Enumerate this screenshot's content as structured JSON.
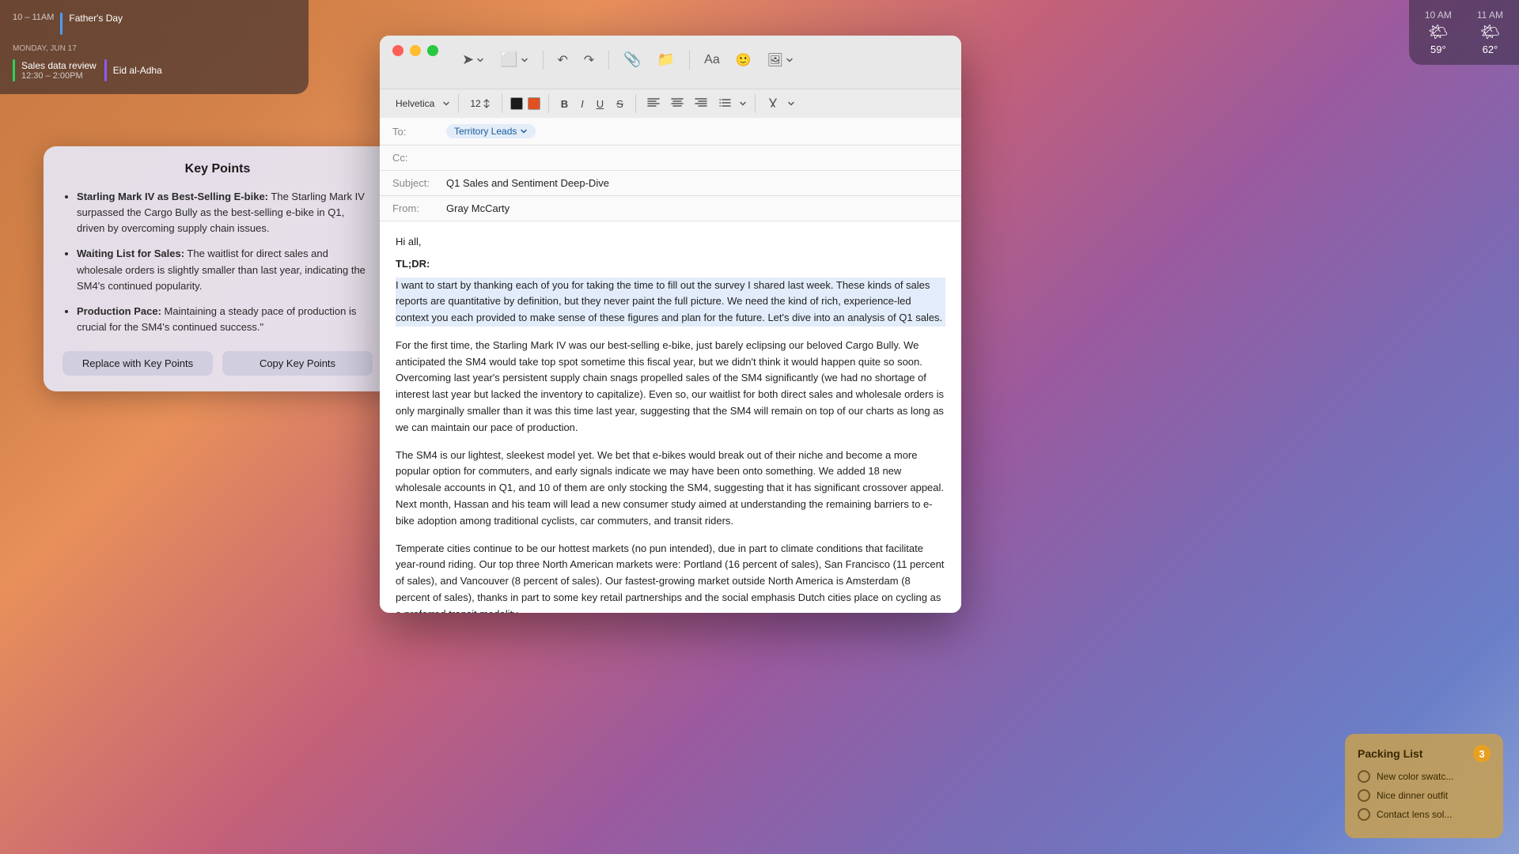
{
  "desktop": {
    "background": "gradient"
  },
  "calendar_widget": {
    "row1_time": "10 – 11AM",
    "row1_event": "Father's Day",
    "row2_label": "MONDAY, JUN 17",
    "row2_time": "12:30 – 2:00PM",
    "row2_event": "Sales data review",
    "row2_event2": "Eid al-Adha"
  },
  "weather_widget": {
    "time1": "10 AM",
    "time2": "11 AM",
    "icon1": "🌤",
    "icon2": "🌤",
    "temp1": "59°",
    "temp2": "62°"
  },
  "packing_list": {
    "title": "Packing List",
    "count": "3",
    "items": [
      {
        "text": "New color swatc...",
        "checked": false
      },
      {
        "text": "Nice dinner outfit",
        "checked": false
      },
      {
        "text": "Contact lens sol...",
        "checked": false
      }
    ]
  },
  "key_points": {
    "title": "Key Points",
    "points": [
      {
        "bold": "Starling Mark IV as Best-Selling E-bike:",
        "text": " The Starling Mark IV surpassed the Cargo Bully as the best-selling e-bike in Q1, driven by overcoming supply chain issues."
      },
      {
        "bold": "Waiting List for Sales:",
        "text": " The waitlist for direct sales and wholesale orders is slightly smaller than last year, indicating the SM4's continued popularity."
      },
      {
        "bold": "Production Pace:",
        "text": " Maintaining a steady pace of production is crucial for the SM4's continued success.\""
      }
    ],
    "btn_replace": "Replace with Key Points",
    "btn_copy": "Copy Key Points"
  },
  "email_window": {
    "to_chip": "Territory Leads",
    "cc": "",
    "subject": "Q1 Sales and Sentiment Deep-Dive",
    "from": "Gray McCarty",
    "toolbar": {
      "send_icon": "➤",
      "attach_icon": "📎",
      "font_name": "Helvetica",
      "font_size": "12",
      "bold": "B",
      "italic": "I",
      "underline": "U",
      "strikethrough": "S"
    },
    "body": {
      "greeting": "Hi all,",
      "tldr": "TL;DR:",
      "para1": "I want to start by thanking each of you for taking the time to fill out the survey I shared last week. These kinds of sales reports are quantitative by definition, but they never paint the full picture. We need the kind of rich, experience-led context you each provided to make sense of these figures and plan for the future. Let's dive into an analysis of Q1 sales.",
      "para2": "For the first time, the Starling Mark IV was our best-selling e-bike, just barely eclipsing our beloved Cargo Bully. We anticipated the SM4 would take top spot sometime this fiscal year, but we didn't think it would happen quite so soon. Overcoming last year's persistent supply chain snags propelled sales of the SM4 significantly (we had no shortage of interest last year but lacked the inventory to capitalize). Even so, our waitlist for both direct sales and wholesale orders is only marginally smaller than it was this time last year, suggesting that the SM4 will remain on top of our charts as long as we can maintain our pace of production.",
      "para3": "The SM4 is our lightest, sleekest model yet. We bet that e-bikes would break out of their niche and become a more popular option for commuters, and early signals indicate we may have been onto something. We added 18 new wholesale accounts in Q1, and 10 of them are only stocking the SM4, suggesting that it has significant crossover appeal. Next month, Hassan and his team will lead a new consumer study aimed at understanding the remaining barriers to e-bike adoption among traditional cyclists, car commuters, and transit riders.",
      "para4": "Temperate cities continue to be our hottest markets (no pun intended), due in part to climate conditions that facilitate year-round riding. Our top three North American markets were: Portland (16 percent of sales), San Francisco (11 percent of sales), and Vancouver (8 percent of sales). Our fastest-growing market outside North America is Amsterdam (8 percent of sales), thanks in part to some key retail partnerships and the social emphasis Dutch cities place on cycling as a preferred transit modality."
    }
  }
}
